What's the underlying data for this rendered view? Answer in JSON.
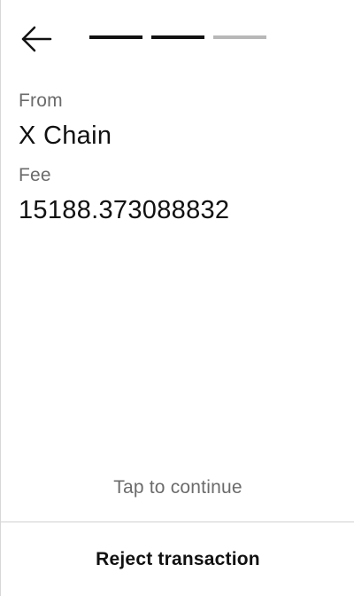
{
  "header": {
    "back_icon": "arrow-left-icon",
    "progress": {
      "total_steps": 3,
      "completed_steps": 2,
      "active_color": "#111111",
      "inactive_color": "#b8b8b8"
    }
  },
  "details": {
    "from_label": "From",
    "from_value": "X Chain",
    "fee_label": "Fee",
    "fee_value": "15188.373088832"
  },
  "footer": {
    "tap_hint": "Tap to continue",
    "reject_label": "Reject transaction"
  }
}
